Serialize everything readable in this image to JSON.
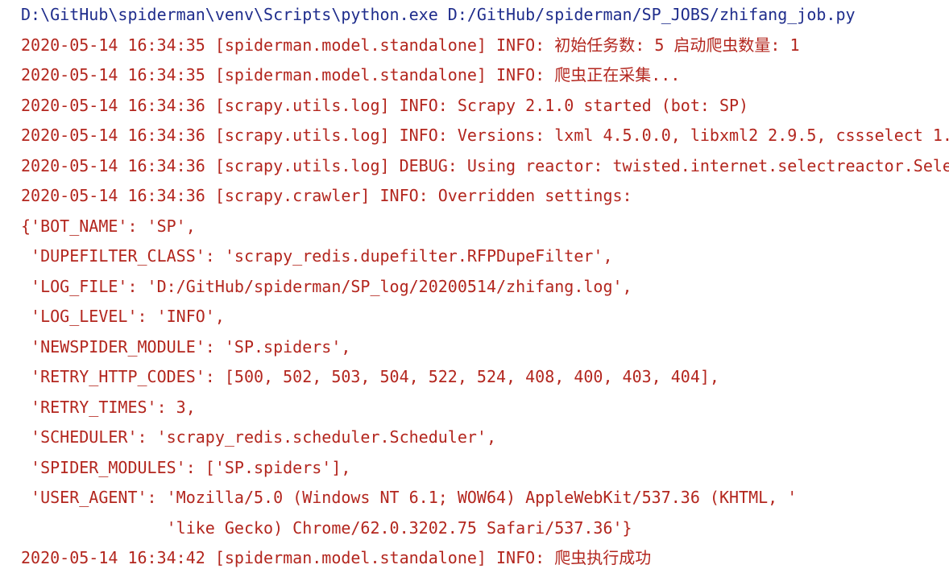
{
  "console": {
    "command": "D:\\GitHub\\spiderman\\venv\\Scripts\\python.exe D:/GitHub/spiderman/SP_JOBS/zhifang_job.py",
    "lines": [
      "2020-05-14 16:34:35 [spiderman.model.standalone] INFO: 初始任务数: 5 启动爬虫数量: 1",
      "2020-05-14 16:34:35 [spiderman.model.standalone] INFO: 爬虫正在采集...",
      "2020-05-14 16:34:36 [scrapy.utils.log] INFO: Scrapy 2.1.0 started (bot: SP)",
      "2020-05-14 16:34:36 [scrapy.utils.log] INFO: Versions: lxml 4.5.0.0, libxml2 2.9.5, cssselect 1.",
      "2020-05-14 16:34:36 [scrapy.utils.log] DEBUG: Using reactor: twisted.internet.selectreactor.Sele",
      "2020-05-14 16:34:36 [scrapy.crawler] INFO: Overridden settings:",
      "{'BOT_NAME': 'SP',",
      " 'DUPEFILTER_CLASS': 'scrapy_redis.dupefilter.RFPDupeFilter',",
      " 'LOG_FILE': 'D:/GitHub/spiderman/SP_log/20200514/zhifang.log',",
      " 'LOG_LEVEL': 'INFO',",
      " 'NEWSPIDER_MODULE': 'SP.spiders',",
      " 'RETRY_HTTP_CODES': [500, 502, 503, 504, 522, 524, 408, 400, 403, 404],",
      " 'RETRY_TIMES': 3,",
      " 'SCHEDULER': 'scrapy_redis.scheduler.Scheduler',",
      " 'SPIDER_MODULES': ['SP.spiders'],",
      " 'USER_AGENT': 'Mozilla/5.0 (Windows NT 6.1; WOW64) AppleWebKit/537.36 (KHTML, '",
      "               'like Gecko) Chrome/62.0.3202.75 Safari/537.36'}",
      "2020-05-14 16:34:42 [spiderman.model.standalone] INFO: 爬虫执行成功"
    ]
  },
  "colors": {
    "command_text": "#1f2d8c",
    "log_text": "#b3261e",
    "background": "#ffffff"
  }
}
